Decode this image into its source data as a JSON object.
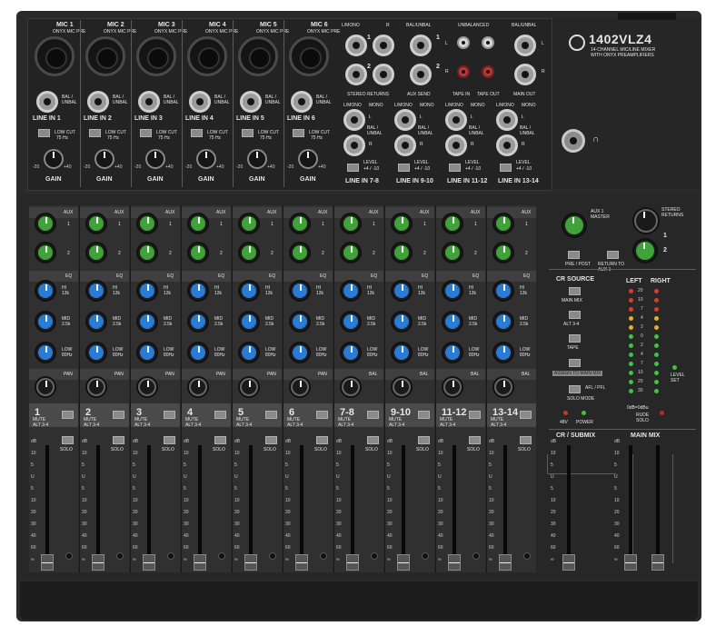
{
  "brand": {
    "model": "1402VLZ4",
    "tagline_1": "14-CHANNEL MIC/LINE MIXER",
    "tagline_2": "WITH ONYX PREAMPLIFIERS"
  },
  "top": {
    "mic_channels": [
      {
        "mic": "MIC 1",
        "line": "LINE IN 1"
      },
      {
        "mic": "MIC 2",
        "line": "LINE IN 2"
      },
      {
        "mic": "MIC 3",
        "line": "LINE IN 3"
      },
      {
        "mic": "MIC 4",
        "line": "LINE IN 4"
      },
      {
        "mic": "MIC 5",
        "line": "LINE IN 5"
      },
      {
        "mic": "MIC 6",
        "line": "LINE IN 6"
      }
    ],
    "onyx": "ONYX MIC PRE",
    "bal_unbal": "BAL / UNBAL",
    "low_cut": "LOW CUT",
    "low_cut_freq": "75 Hz",
    "gain": "GAIN",
    "gain_scale": [
      "-20",
      "+40"
    ],
    "stereo_returns": "STEREO RETURNS",
    "aux_send": "AUX SEND",
    "l_mono": "L/MONO",
    "r": "R",
    "bal_unbal_short": "BAL/UNBAL",
    "unbalanced": "UNBALANCED",
    "tape_in": "TAPE IN",
    "tape_out": "TAPE OUT",
    "main_out": "MAIN OUT",
    "l": "L",
    "mono": "MONO",
    "level": "LEVEL",
    "level_opts": "+4 / -10",
    "stereo_lines": [
      {
        "label": "LINE IN 7-8"
      },
      {
        "label": "LINE IN 9-10"
      },
      {
        "label": "LINE IN 11-12"
      },
      {
        "label": "LINE IN 13-14"
      }
    ],
    "num_1": "1",
    "num_2": "2"
  },
  "strips": [
    {
      "number": "1",
      "lower": "PAN"
    },
    {
      "number": "2",
      "lower": "PAN"
    },
    {
      "number": "3",
      "lower": "PAN"
    },
    {
      "number": "4",
      "lower": "PAN"
    },
    {
      "number": "5",
      "lower": "PAN"
    },
    {
      "number": "6",
      "lower": "PAN"
    },
    {
      "number": "7-8",
      "lower": "BAL"
    },
    {
      "number": "9-10",
      "lower": "BAL"
    },
    {
      "number": "11-12",
      "lower": "BAL"
    },
    {
      "number": "13-14",
      "lower": "BAL"
    }
  ],
  "strip_labels": {
    "aux": "AUX",
    "aux1": "1",
    "aux2": "2",
    "eq": "EQ",
    "hi": "HI",
    "hi_freq": "12k",
    "mid": "MID",
    "mid_freq": "2.5k",
    "low": "LOW",
    "low_freq": "80Hz",
    "mute": "MUTE",
    "alt": "ALT 3-4",
    "solo": "SOLO"
  },
  "master": {
    "aux1_master": "AUX 1 MASTER",
    "stereo_returns": "STEREO RETURNS",
    "pre_post": "PRE / POST",
    "return_to_aux1": "RETURN TO AUX 1",
    "ret_1": "1",
    "ret_2": "2",
    "cr_source": "CR SOURCE",
    "main_mix": "MAIN MIX",
    "alt_34": "ALT 3-4",
    "tape": "TAPE",
    "assign_to_main_mix": "ASSIGN TO MAIN MIX",
    "solo_mode": "SOLO MODE",
    "afl_pfl": "AFL / PFL",
    "phantom": "48V",
    "power": "POWER",
    "left": "LEFT",
    "right": "RIGHT",
    "meter_scale": [
      "20",
      "10",
      "7",
      "4",
      "2",
      "0",
      "2",
      "4",
      "7",
      "10",
      "20",
      "30"
    ],
    "level_set": "LEVEL SET",
    "odb_note": "0dB=0dBu",
    "rude_solo": "RUDE SOLO",
    "cr_submix": "CR / SUBMIX",
    "main_mix_fader": "MAIN MIX"
  },
  "fader_scale": [
    "dB",
    "10",
    "5",
    "U",
    "5",
    "10",
    "20",
    "30",
    "40",
    "60",
    "∞"
  ]
}
